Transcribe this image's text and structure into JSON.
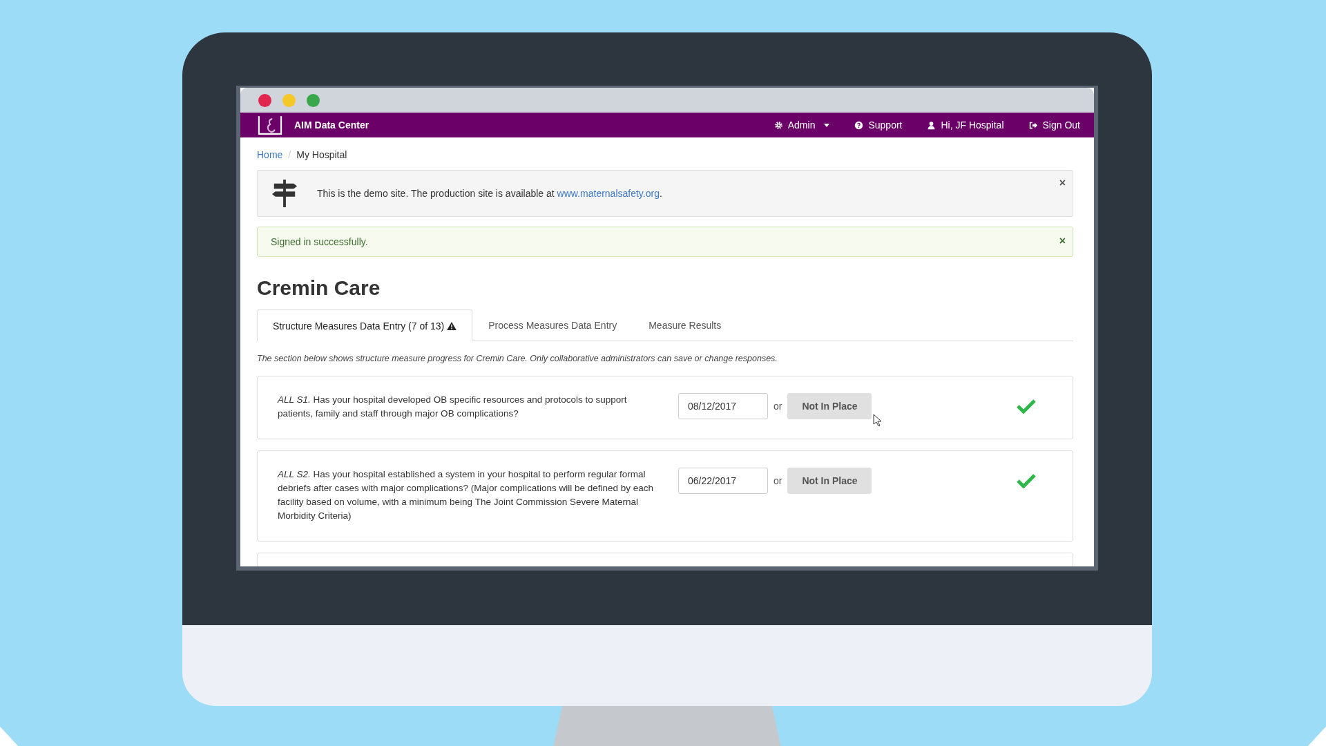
{
  "window_controls": [
    {
      "color": "#e0284f"
    },
    {
      "color": "#f5c82a"
    },
    {
      "color": "#3aa84a"
    }
  ],
  "navbar": {
    "brand": "AIM Data Center",
    "items": [
      {
        "label": "Admin",
        "kind": "admin",
        "dropdown": true
      },
      {
        "label": "Support",
        "kind": "help",
        "dropdown": false
      },
      {
        "label": "Hi, JF Hospital",
        "kind": "user",
        "dropdown": false
      },
      {
        "label": "Sign Out",
        "kind": "signout",
        "dropdown": false
      }
    ]
  },
  "breadcrumb": [
    {
      "label": "Home",
      "kind": "link"
    },
    {
      "label": "My Hospital",
      "kind": "current",
      "separator": "/"
    }
  ],
  "alerts": [
    {
      "kind": "info",
      "text": "This is the demo site. The production site is available at ",
      "link": "www.maternalsafety.org",
      "after": ".",
      "close": "×"
    },
    {
      "kind": "success",
      "text": "Signed in successfully.",
      "close": "×"
    }
  ],
  "heading": "Cremin Care",
  "tabs": [
    {
      "label": "Structure Measures Data Entry (7 of 13)",
      "selected": true,
      "warning": true
    },
    {
      "label": "Process Measures Data Entry",
      "selected": false,
      "warning": false
    },
    {
      "label": "Measure Results",
      "selected": false,
      "warning": false
    }
  ],
  "note": "The section below shows structure measure progress for Cremin Care. Only collaborative administrators can save or change responses.",
  "measures": [
    {
      "question": "*ALL S1.* Has your hospital developed OB specific resources and protocols to support patients, family and staff through major OB complications?",
      "date": "08/12/2017",
      "or": "or",
      "button": "Not In Place",
      "complete": true
    },
    {
      "question": "*ALL S2.* Has your hospital established a system in your hospital to perform regular formal debriefs after cases with major complications? (Major complications will be defined by each facility based on volume, with a minimum being The Joint Commission Severe Maternal Morbidity Criteria)",
      "date": "06/22/2017",
      "or": "or",
      "button": "Not In Place",
      "complete": true
    }
  ]
}
